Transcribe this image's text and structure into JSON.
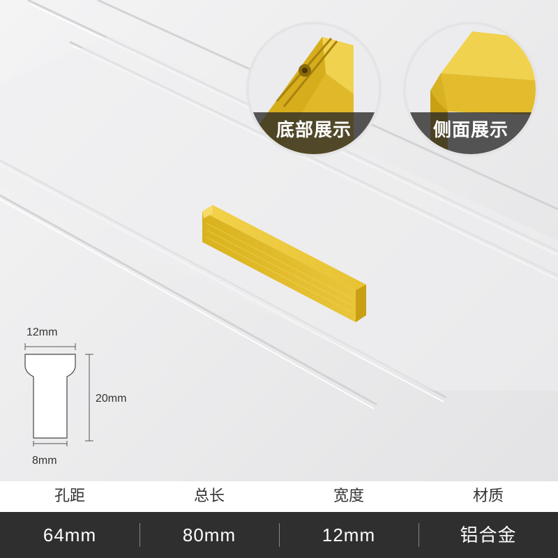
{
  "callouts": {
    "bottom_view_label": "底部展示",
    "side_view_label": "侧面展示"
  },
  "profile_dimensions": {
    "top_width": "12mm",
    "height": "20mm",
    "bottom_width": "8mm"
  },
  "spec_table": {
    "headers": [
      "孔距",
      "总长",
      "宽度",
      "材质"
    ],
    "values": [
      "64mm",
      "80mm",
      "12mm",
      "铝合金"
    ]
  },
  "colors": {
    "gold": "#e2bc2c",
    "background": "#e9e9eb",
    "spec_bar": "#2f2f2f"
  }
}
